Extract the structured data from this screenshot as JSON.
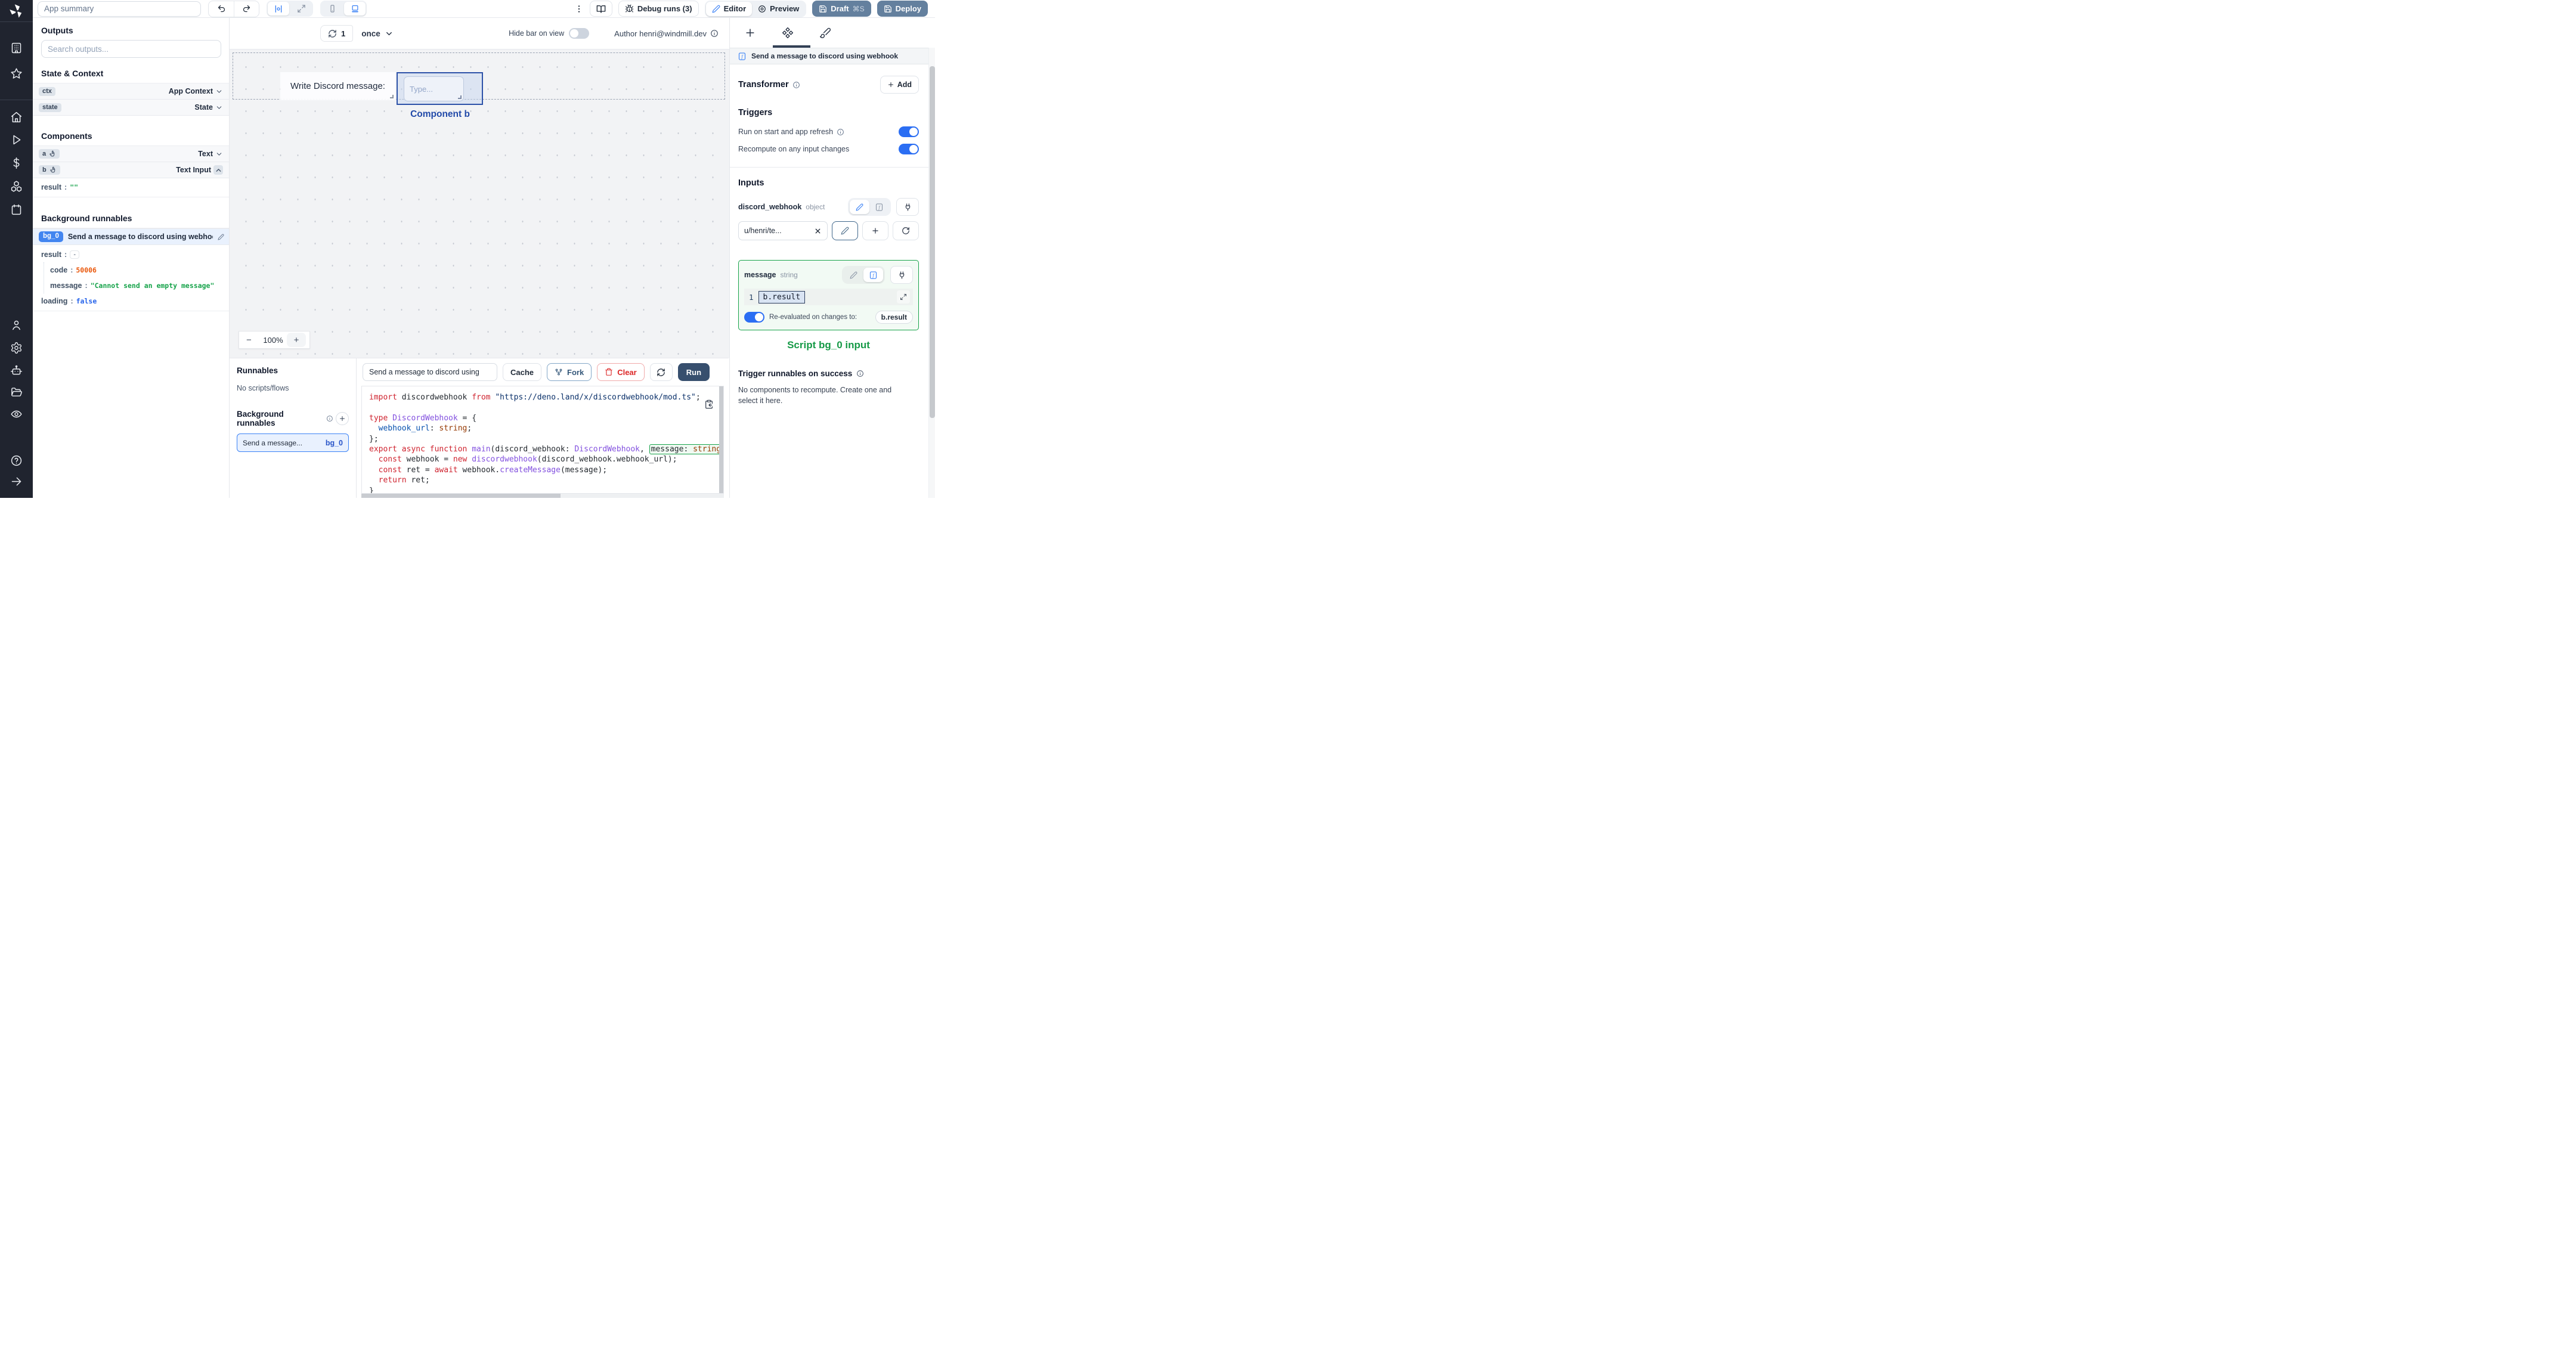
{
  "topbar": {
    "summary_placeholder": "App summary",
    "debug_label": "Debug runs (3)",
    "editor_label": "Editor",
    "preview_label": "Preview",
    "draft_label": "Draft",
    "draft_kbd": "⌘S",
    "deploy_label": "Deploy"
  },
  "canvasbar": {
    "refresh_count": "1",
    "mode": "once",
    "hide_label": "Hide bar on view",
    "author": "Author henri@windmill.dev"
  },
  "canvas": {
    "component_a_text": "Write Discord message:",
    "input_placeholder": "Type...",
    "selected_label": "Component b",
    "zoom_out": "−",
    "zoom_level": "100%",
    "zoom_in": "+"
  },
  "outputs": {
    "title": "Outputs",
    "search_placeholder": "Search outputs...",
    "state_section": "State & Context",
    "components_section": "Components",
    "background_section": "Background runnables",
    "ctx": {
      "id": "ctx",
      "type": "App Context"
    },
    "state": {
      "id": "state",
      "type": "State"
    },
    "a": {
      "id": "a",
      "type": "Text"
    },
    "b": {
      "id": "b",
      "type": "Text Input"
    },
    "b_result": {
      "key": "result",
      "colon": ":",
      "value": "\"\""
    },
    "bg": {
      "badge": "bg_0",
      "title": "Send a message to discord using webhook",
      "result_key": "result",
      "colon": ":",
      "collapse": "-",
      "code_key": "code",
      "code_value": "50006",
      "message_key": "message",
      "message_value": "\"Cannot send an empty message\"",
      "loading_key": "loading",
      "loading_value": "false"
    }
  },
  "runnables": {
    "title": "Runnables",
    "empty": "No scripts/flows",
    "background_title": "Background runnables",
    "item_label": "Send a message...",
    "item_badge": "bg_0"
  },
  "codebar": {
    "name_value": "Send a message to discord using",
    "cache": "Cache",
    "fork": "Fork",
    "clear": "Clear",
    "run": "Run"
  },
  "code": {
    "lines": [
      [
        {
          "t": "import",
          "c": "k"
        },
        {
          "t": " discordwebhook ",
          "c": "d"
        },
        {
          "t": "from",
          "c": "k"
        },
        {
          "t": " \"https://deno.land/x/discordwebhook/mod.ts\"",
          "c": "s"
        },
        {
          "t": ";",
          "c": "d"
        }
      ],
      [],
      [
        {
          "t": "type",
          "c": "k"
        },
        {
          "t": " ",
          "c": "d"
        },
        {
          "t": "DiscordWebhook",
          "c": "t"
        },
        {
          "t": " = {",
          "c": "d"
        }
      ],
      [
        {
          "t": "  ",
          "c": "d"
        },
        {
          "t": "webhook_url",
          "c": "v"
        },
        {
          "t": ": ",
          "c": "d"
        },
        {
          "t": "string",
          "c": "b"
        },
        {
          "t": ";",
          "c": "d"
        }
      ],
      [
        {
          "t": "};",
          "c": "d"
        }
      ],
      [
        {
          "t": "export",
          "c": "k"
        },
        {
          "t": " ",
          "c": "d"
        },
        {
          "t": "async",
          "c": "k"
        },
        {
          "t": " ",
          "c": "d"
        },
        {
          "t": "function",
          "c": "k"
        },
        {
          "t": " ",
          "c": "d"
        },
        {
          "t": "main",
          "c": "t"
        },
        {
          "t": "(discord_webhook: ",
          "c": "d"
        },
        {
          "t": "DiscordWebhook",
          "c": "t"
        },
        {
          "t": ", ",
          "c": "d"
        },
        {
          "t": "message: ",
          "c": "d",
          "h": 1
        },
        {
          "t": "string",
          "c": "b",
          "h": 1
        },
        {
          "t": ") {",
          "c": "d"
        }
      ],
      [
        {
          "t": "  ",
          "c": "d"
        },
        {
          "t": "const",
          "c": "k"
        },
        {
          "t": " webhook = ",
          "c": "d"
        },
        {
          "t": "new",
          "c": "k"
        },
        {
          "t": " ",
          "c": "d"
        },
        {
          "t": "discordwebhook",
          "c": "t"
        },
        {
          "t": "(discord_webhook.webhook_url);",
          "c": "d"
        }
      ],
      [
        {
          "t": "  ",
          "c": "d"
        },
        {
          "t": "const",
          "c": "k"
        },
        {
          "t": " ret = ",
          "c": "d"
        },
        {
          "t": "await",
          "c": "k"
        },
        {
          "t": " webhook.",
          "c": "d"
        },
        {
          "t": "createMessage",
          "c": "t"
        },
        {
          "t": "(message);",
          "c": "d"
        }
      ],
      [
        {
          "t": "  ",
          "c": "d"
        },
        {
          "t": "return",
          "c": "k"
        },
        {
          "t": " ret;",
          "c": "d"
        }
      ],
      [
        {
          "t": "}",
          "c": "d"
        }
      ]
    ]
  },
  "right": {
    "header_title": "Send a message to discord using webhook",
    "transformer_label": "Transformer",
    "add_label": "Add",
    "triggers_title": "Triggers",
    "trigger1": "Run on start and app refresh",
    "trigger2": "Recompute on any input changes",
    "inputs_title": "Inputs",
    "input1": {
      "name": "discord_webhook",
      "type": "object",
      "value": "u/henri/te..."
    },
    "input2": {
      "name": "message",
      "type": "string",
      "line_no": "1",
      "expr": "b.result",
      "reeval_label": "Re-evaluated on changes to:",
      "reeval_target": "b.result"
    },
    "script_label": "Script bg_0 input",
    "success_title": "Trigger runnables on success",
    "success_text": "No components to recompute. Create one and select it here."
  },
  "colors": {
    "accent_blue": "#2b6ef3",
    "selection_blue": "#2d52a8",
    "success_green": "#17a34a",
    "error_orange": "#ea580c",
    "slate_button": "#64809e",
    "run_button": "#374f6e"
  }
}
